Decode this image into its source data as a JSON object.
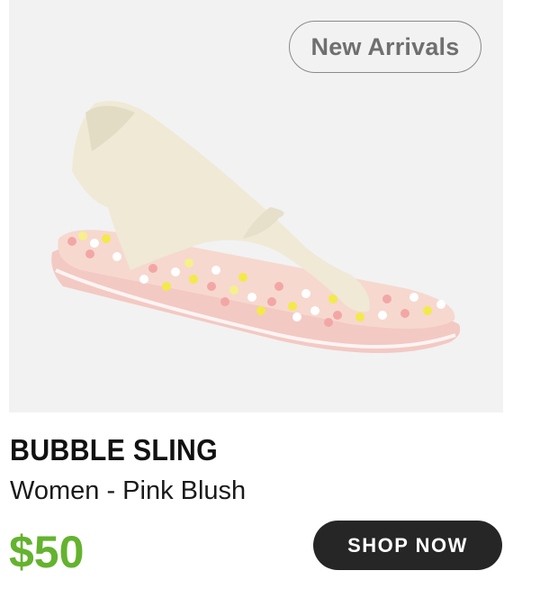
{
  "badge": {
    "label": "New Arrivals"
  },
  "product": {
    "name": "BUBBLE SLING",
    "variant": "Women - Pink Blush",
    "price": "$50"
  },
  "cta": {
    "label": "SHOP NOW"
  },
  "colors": {
    "price": "#64b32f",
    "button_bg": "#262626",
    "image_bg": "#f2f2f2"
  }
}
